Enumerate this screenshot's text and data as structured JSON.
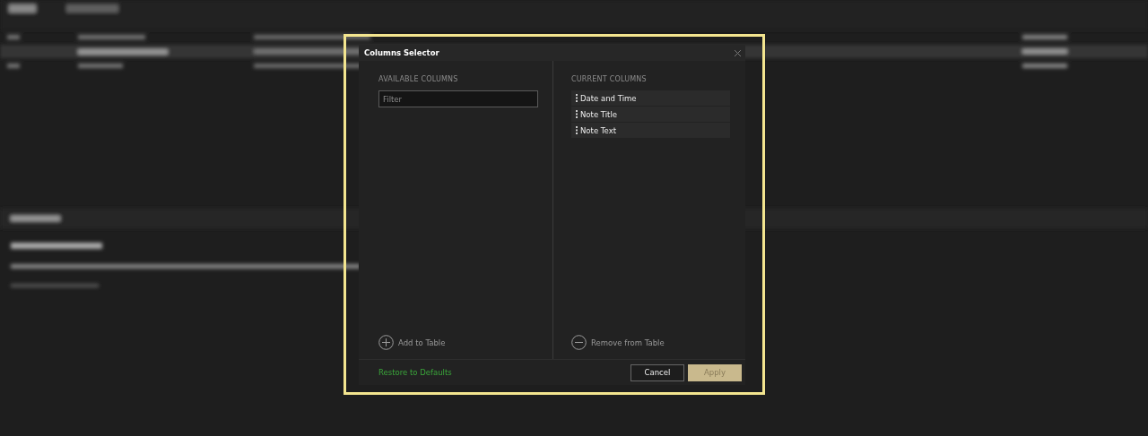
{
  "dialog": {
    "title": "Columns Selector",
    "available": {
      "heading": "AVAILABLE COLUMNS",
      "filter": {
        "placeholder": "Filter"
      },
      "action": "Add to Table"
    },
    "current": {
      "heading": "CURRENT COLUMNS",
      "items": [
        {
          "label": "Date and Time"
        },
        {
          "label": "Note Title"
        },
        {
          "label": "Note Text"
        }
      ],
      "action": "Remove from Table"
    },
    "footer": {
      "link": "Restore to Defaults",
      "buttons": [
        {
          "label": "Cancel",
          "kind": "secondary"
        },
        {
          "label": "Apply",
          "kind": "primary"
        }
      ]
    }
  }
}
